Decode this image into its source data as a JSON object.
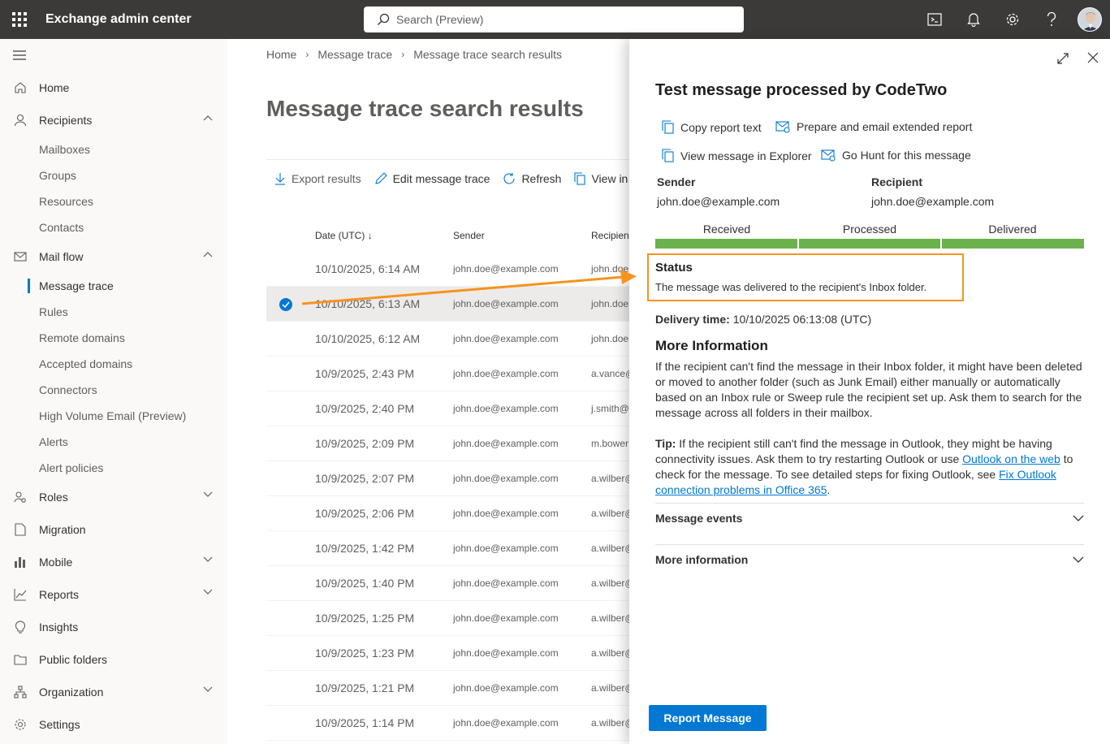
{
  "app": {
    "title": "Exchange admin center",
    "search_placeholder": "Search (Preview)",
    "accent": "#0078d4",
    "topbar_bg": "#3b3a39"
  },
  "sidebar": {
    "items": [
      {
        "label": "Home",
        "icon": "home-icon"
      },
      {
        "label": "Recipients",
        "icon": "person-icon",
        "expanded": true
      },
      {
        "label": "Mailboxes",
        "sub": true
      },
      {
        "label": "Groups",
        "sub": true
      },
      {
        "label": "Resources",
        "sub": true
      },
      {
        "label": "Contacts",
        "sub": true
      },
      {
        "label": "Mail flow",
        "icon": "mail-icon",
        "expanded": true
      },
      {
        "label": "Message trace",
        "sub": true,
        "active": true
      },
      {
        "label": "Rules",
        "sub": true
      },
      {
        "label": "Remote domains",
        "sub": true
      },
      {
        "label": "Accepted domains",
        "sub": true
      },
      {
        "label": "Connectors",
        "sub": true
      },
      {
        "label": "High Volume Email (Preview)",
        "sub": true
      },
      {
        "label": "Alerts",
        "sub": true
      },
      {
        "label": "Alert policies",
        "sub": true
      },
      {
        "label": "Roles",
        "icon": "roles-icon"
      },
      {
        "label": "Migration",
        "icon": "migration-icon"
      },
      {
        "label": "Mobile",
        "icon": "mobile-icon"
      },
      {
        "label": "Reports",
        "icon": "reports-icon"
      },
      {
        "label": "Insights",
        "icon": "lightbulb-icon"
      },
      {
        "label": "Public folders",
        "icon": "folder-icon"
      },
      {
        "label": "Organization",
        "icon": "organization-icon"
      },
      {
        "label": "Settings",
        "icon": "gear-icon"
      }
    ]
  },
  "breadcrumb": [
    "Home",
    "Message trace",
    "Message trace search results"
  ],
  "page_title": "Message trace search results",
  "toolbar": {
    "export": "Export results",
    "edit": "Edit message trace",
    "refresh": "Refresh",
    "view": "View in E"
  },
  "grid": {
    "headers": {
      "date": "Date (UTC)",
      "sender": "Sender",
      "recipient": "Recipient"
    },
    "rows": [
      {
        "date": "10/10/2025, 6:14 AM",
        "sender": "john.doe@example.com",
        "recipient": "john.doe"
      },
      {
        "date": "10/10/2025, 6:13 AM",
        "sender": "john.doe@example.com",
        "recipient": "john.doe",
        "selected": true
      },
      {
        "date": "10/10/2025, 6:12 AM",
        "sender": "john.doe@example.com",
        "recipient": "john.doe"
      },
      {
        "date": "10/9/2025, 2:43 PM",
        "sender": "john.doe@example.com",
        "recipient": "a.vance@"
      },
      {
        "date": "10/9/2025, 2:40 PM",
        "sender": "john.doe@example.com",
        "recipient": "j.smith@"
      },
      {
        "date": "10/9/2025, 2:09 PM",
        "sender": "john.doe@example.com",
        "recipient": "m.bower"
      },
      {
        "date": "10/9/2025, 2:07 PM",
        "sender": "john.doe@example.com",
        "recipient": "a.wilber@"
      },
      {
        "date": "10/9/2025, 2:06 PM",
        "sender": "john.doe@example.com",
        "recipient": "a.wilber@"
      },
      {
        "date": "10/9/2025, 1:42 PM",
        "sender": "john.doe@example.com",
        "recipient": "a.wilber@"
      },
      {
        "date": "10/9/2025, 1:40 PM",
        "sender": "john.doe@example.com",
        "recipient": "a.wilber@"
      },
      {
        "date": "10/9/2025, 1:25 PM",
        "sender": "john.doe@example.com",
        "recipient": "a.wilber@"
      },
      {
        "date": "10/9/2025, 1:23 PM",
        "sender": "john.doe@example.com",
        "recipient": "a.wilber@"
      },
      {
        "date": "10/9/2025, 1:21 PM",
        "sender": "john.doe@example.com",
        "recipient": "a.wilber@"
      },
      {
        "date": "10/9/2025, 1:14 PM",
        "sender": "john.doe@example.com",
        "recipient": "a.wilber@"
      }
    ]
  },
  "panel": {
    "title": "Test message processed by CodeTwo",
    "actions": {
      "copy": "Copy report text",
      "prepare": "Prepare and email extended report",
      "view": "View message in Explorer",
      "hunt": "Go Hunt for this message"
    },
    "sender_label": "Sender",
    "sender": "john.doe@example.com",
    "recipient_label": "Recipient",
    "recipient": "john.doe@example.com",
    "steps": [
      "Received",
      "Processed",
      "Delivered"
    ],
    "step_color": "#6bb24c",
    "status_title": "Status",
    "status_text": "The message was delivered to the recipient's Inbox folder.",
    "highlight_color": "#f7931e",
    "delivery_label": "Delivery time:",
    "delivery_value": "10/10/2025 06:13:08 (UTC)",
    "more_title": "More Information",
    "more_text": "If the recipient can't find the message in their Inbox folder, it might have been deleted or moved to another folder (such as Junk Email) either manually or automatically based on an Inbox rule or Sweep rule the recipient set up. Ask them to search for the message across all folders in their mailbox.",
    "tip_label": "Tip:",
    "tip_text_1": "If the recipient still can't find the message in Outlook, they might be having connectivity issues. Ask them to try restarting Outlook or use",
    "tip_link_1": "Outlook on the web",
    "tip_text_2": "to check for the message. To see detailed steps for fixing Outlook, see",
    "tip_link_2": "Fix Outlook connection problems in Office 365",
    "tip_text_3": ".",
    "accordion_1": "Message events",
    "accordion_2": "More information",
    "report_button": "Report Message"
  }
}
